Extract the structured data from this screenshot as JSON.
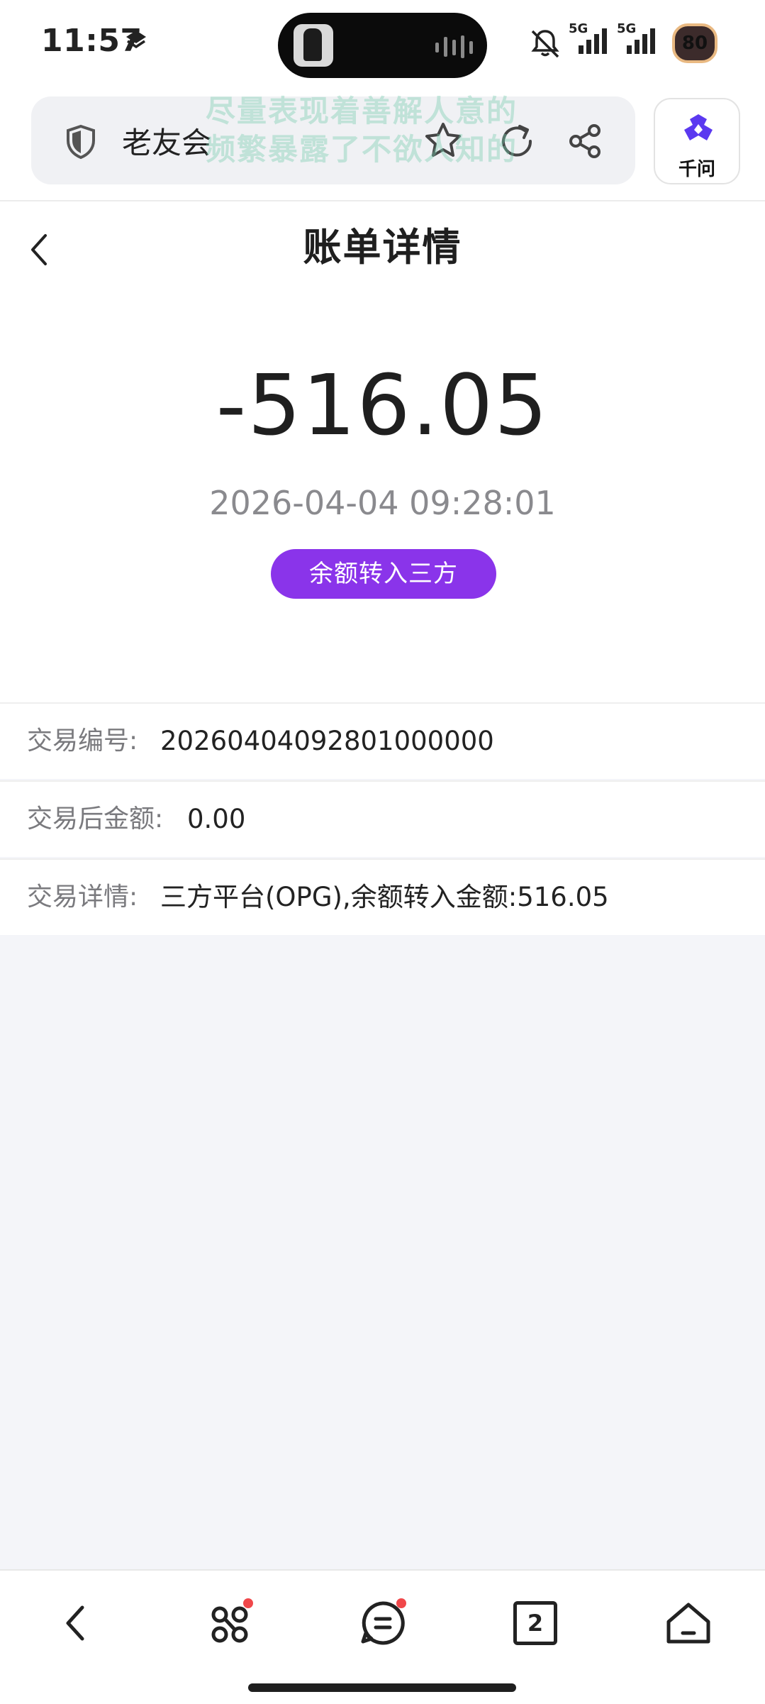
{
  "status_bar": {
    "time": "11:57",
    "network_1": "5G",
    "network_2": "5G",
    "battery": "80"
  },
  "browser": {
    "site_title": "老友会",
    "overlay_lines": [
      "尽量表现着善解人意的",
      "频繁暴露了不欲人知的"
    ],
    "ai_button_label": "千问"
  },
  "page": {
    "title": "账单详情"
  },
  "bill": {
    "amount": "-516.05",
    "datetime": "2026-04-04 09:28:01",
    "type_badge": "余额转入三方"
  },
  "details": [
    {
      "label": "交易编号:",
      "value": "20260404092801000000"
    },
    {
      "label": "交易后金额:",
      "value": "0.00"
    },
    {
      "label": "交易详情:",
      "value": "三方平台(OPG),余额转入金额:516.05"
    }
  ],
  "bottom_nav": {
    "tab_count": "2"
  },
  "icons": {
    "shield": "shield-icon",
    "star": "star-icon",
    "refresh": "refresh-icon",
    "share": "share-icon",
    "back": "chevron-left-icon",
    "apps": "apps-icon",
    "menu": "menu-icon",
    "tabs": "tabs-icon",
    "home": "home-icon"
  },
  "colors": {
    "accent": "#8a34ea",
    "background": "#f4f5f9",
    "notification_dot": "#f0474a"
  }
}
